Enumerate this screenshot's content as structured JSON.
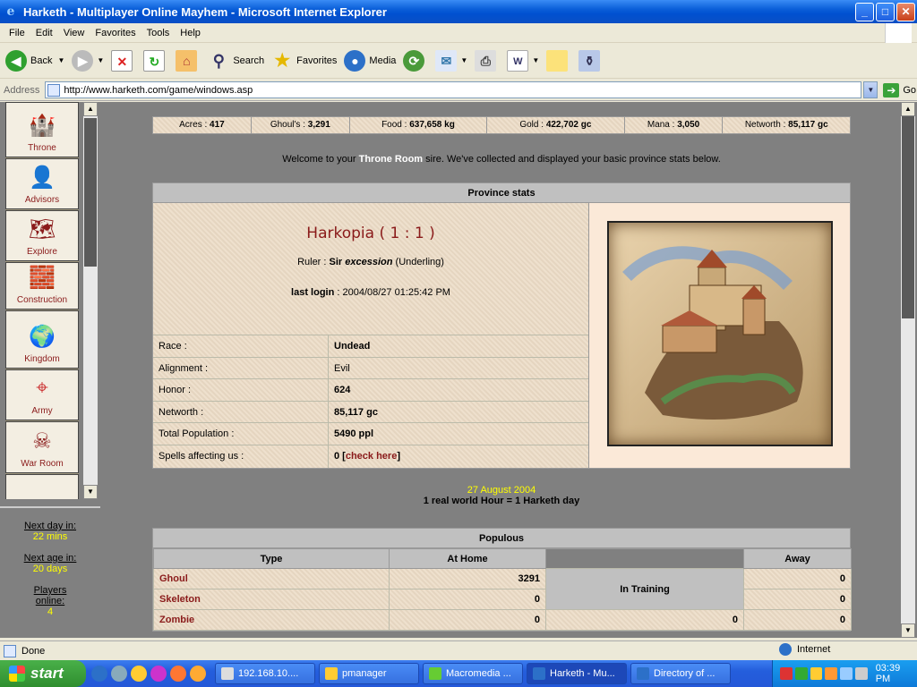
{
  "window": {
    "title": "Harketh - Multiplayer Online Mayhem - Microsoft Internet Explorer",
    "ie_glyph": "e"
  },
  "window_buttons": {
    "minimize": "_",
    "maximize": "□",
    "close": "✕"
  },
  "menu": [
    "File",
    "Edit",
    "View",
    "Favorites",
    "Tools",
    "Help"
  ],
  "toolbar": {
    "back": "Back",
    "search": "Search",
    "favorites": "Favorites",
    "media": "Media"
  },
  "address": {
    "label": "Address",
    "url": "http://www.harketh.com/game/windows.asp",
    "go": "Go"
  },
  "nav": {
    "items": [
      {
        "label": "Throne",
        "icon": "castle-icon",
        "glyph": "🏰"
      },
      {
        "label": "Advisors",
        "icon": "advisor-face-icon",
        "glyph": "👤"
      },
      {
        "label": "Explore",
        "icon": "map-icon",
        "glyph": "🗺"
      },
      {
        "label": "Construction",
        "icon": "bricks-icon",
        "glyph": "🧱"
      },
      {
        "label": "Kingdom",
        "icon": "globe-flag-icon",
        "glyph": "🌍"
      },
      {
        "label": "Army",
        "icon": "crosshair-icon",
        "glyph": "⌖"
      },
      {
        "label": "War Room",
        "icon": "skull-crossbones-icon",
        "glyph": "☠"
      },
      {
        "label": "",
        "icon": "door-icon",
        "glyph": "▦"
      }
    ]
  },
  "nav_info": {
    "next_day_label": "Next day in:",
    "next_day": "22 mins",
    "next_age_label": "Next age in:",
    "next_age": "20 days",
    "players_label": "Players online:",
    "players": "4"
  },
  "stats": [
    {
      "k": "Acres : ",
      "v": "417"
    },
    {
      "k": "Ghoul's : ",
      "v": "3,291"
    },
    {
      "k": "Food : ",
      "v": "637,658 kg"
    },
    {
      "k": "Gold : ",
      "v": "422,702 gc"
    },
    {
      "k": "Mana : ",
      "v": "3,050"
    },
    {
      "k": "Networth : ",
      "v": "85,117 gc"
    }
  ],
  "welcome": {
    "pre": "Welcome to your ",
    "room": "Throne Room",
    "post": " sire. We've collected and displayed your basic province stats below."
  },
  "province": {
    "header": "Province stats",
    "name": "Harkopia ( 1 : 1 )",
    "ruler_label": "Ruler : ",
    "ruler_title": "Sir ",
    "ruler_name": "excession",
    "ruler_rank": " (Underling)",
    "login_label": "last login",
    "login_value": " : 2004/08/27 01:25:42 PM",
    "rows": [
      {
        "k": "Race :",
        "v": "Undead"
      },
      {
        "k": "Alignment :",
        "v": "Evil"
      },
      {
        "k": "Honor :",
        "v": "624"
      },
      {
        "k": "Networth :",
        "v": "85,117 gc"
      },
      {
        "k": "Total Population :",
        "v": "5490 ppl"
      },
      {
        "k": "Spells affecting us :",
        "v": "0 [",
        "link": "check here",
        "end": "]"
      }
    ]
  },
  "date": {
    "day": "27 August 2004",
    "note": "1 real world Hour = 1 Harketh day"
  },
  "populous": {
    "header": "Populous",
    "cols": [
      "Type",
      "At Home",
      "In Training",
      "Away"
    ],
    "rows": [
      {
        "type": "Ghoul",
        "home": "3291",
        "train": "",
        "away": "0"
      },
      {
        "type": "Skeleton",
        "home": "0",
        "train": "",
        "away": "0"
      },
      {
        "type": "Zombie",
        "home": "0",
        "train": "0",
        "away": "0"
      }
    ]
  },
  "status": {
    "text": "Done",
    "zone": "Internet"
  },
  "taskbar": {
    "start": "start",
    "tasks": [
      "192.168.10....",
      "pmanager",
      "Macromedia ...",
      "Harketh - Mu...",
      "Directory of ..."
    ],
    "clock": "03:39 PM"
  },
  "colors": {
    "title_blue": "#0a5ed8",
    "parchment": "#ecdcc6",
    "dark_red": "#8a1a1a",
    "yellow": "#ffff00"
  }
}
